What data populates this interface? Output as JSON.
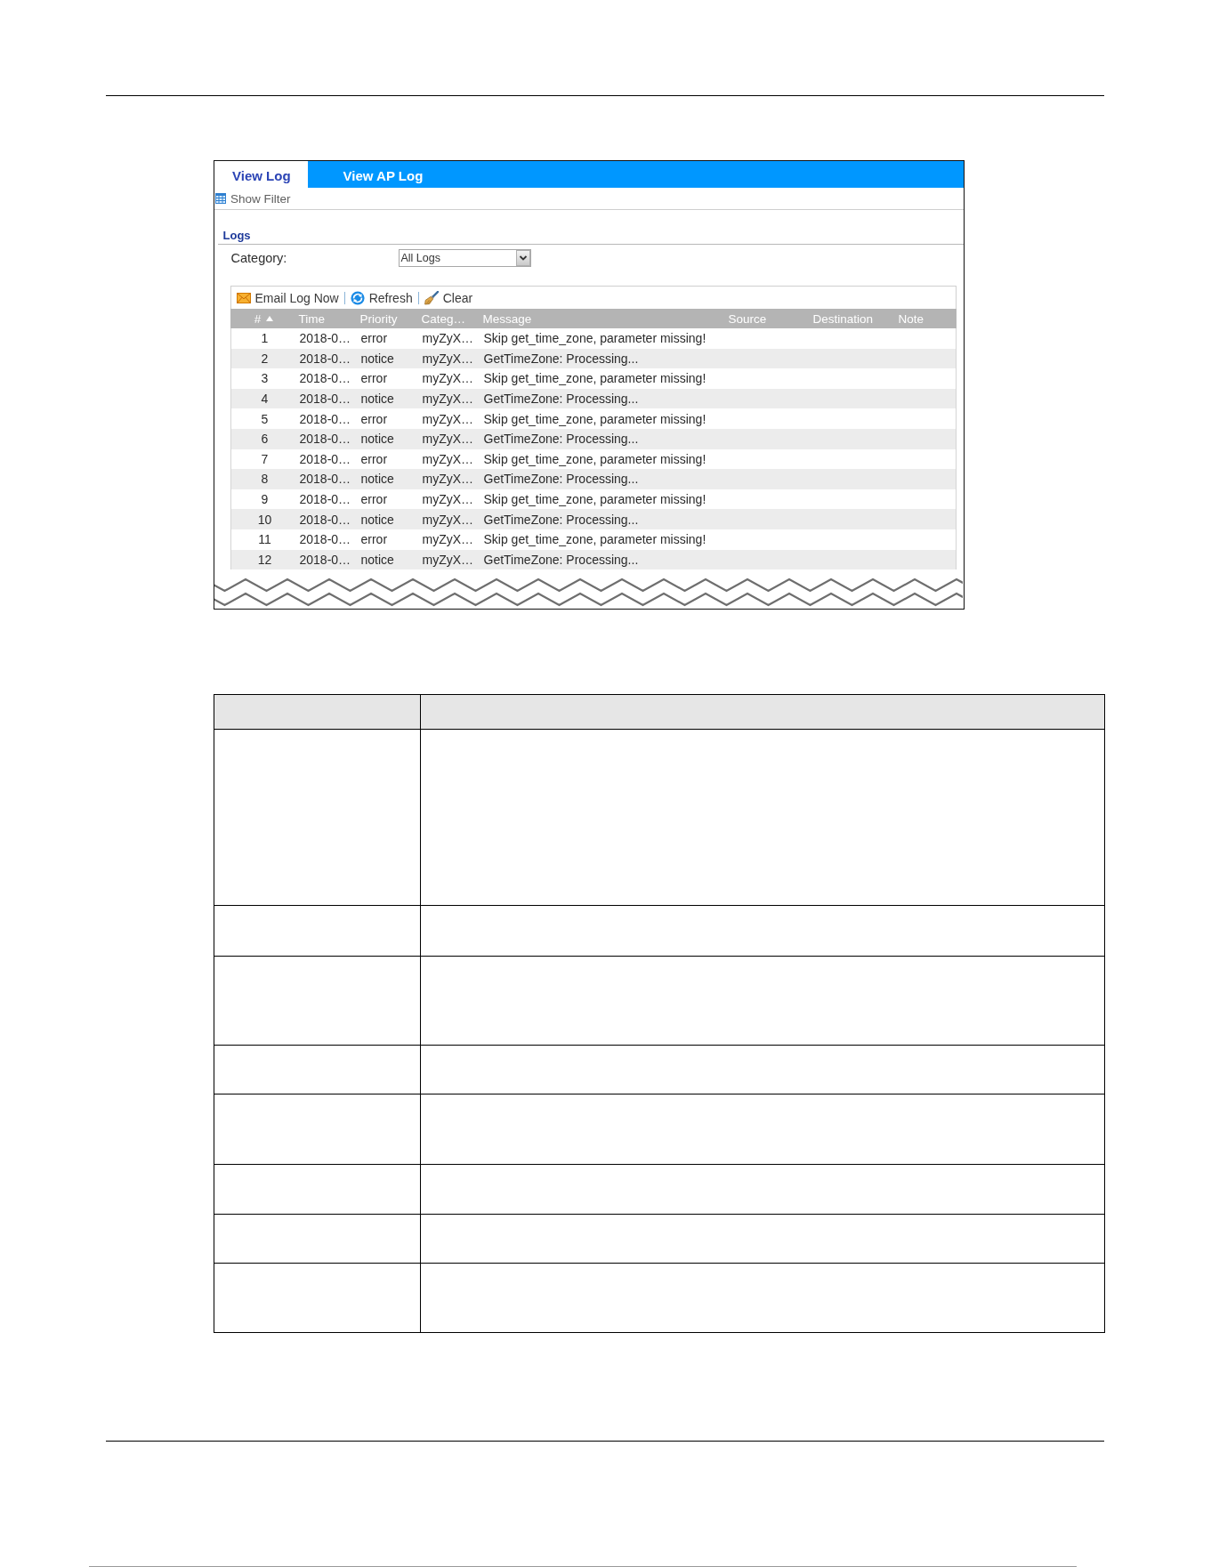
{
  "tabs": [
    {
      "label": "View Log",
      "selected": true
    },
    {
      "label": "View AP Log",
      "selected": false
    }
  ],
  "filter_toggle": {
    "label": "Show Filter"
  },
  "logs": {
    "title": "Logs",
    "category": {
      "label": "Category:",
      "value": "All Logs"
    },
    "toolbar": [
      {
        "kind": "email",
        "label": "Email Log Now"
      },
      {
        "kind": "refresh",
        "label": "Refresh"
      },
      {
        "kind": "clear",
        "label": "Clear"
      }
    ],
    "table": {
      "columns": [
        {
          "label": "#",
          "sorted": true
        },
        {
          "label": "Time",
          "sorted": false
        },
        {
          "label": "Priority",
          "sorted": false
        },
        {
          "label": "Categ…",
          "sorted": false
        },
        {
          "label": "Message",
          "sorted": false
        },
        {
          "label": "Source",
          "sorted": false
        },
        {
          "label": "Destination",
          "sorted": false
        },
        {
          "label": "Note",
          "sorted": false
        }
      ],
      "rows": [
        {
          "cells": [
            "1",
            "2018-0…",
            "error",
            "myZyX…",
            "Skip get_time_zone, parameter missing!"
          ]
        },
        {
          "cells": [
            "2",
            "2018-0…",
            "notice",
            "myZyX…",
            "GetTimeZone: Processing..."
          ]
        },
        {
          "cells": [
            "3",
            "2018-0…",
            "error",
            "myZyX…",
            "Skip get_time_zone, parameter missing!"
          ]
        },
        {
          "cells": [
            "4",
            "2018-0…",
            "notice",
            "myZyX…",
            "GetTimeZone: Processing..."
          ]
        },
        {
          "cells": [
            "5",
            "2018-0…",
            "error",
            "myZyX…",
            "Skip get_time_zone, parameter missing!"
          ]
        },
        {
          "cells": [
            "6",
            "2018-0…",
            "notice",
            "myZyX…",
            "GetTimeZone: Processing..."
          ]
        },
        {
          "cells": [
            "7",
            "2018-0…",
            "error",
            "myZyX…",
            "Skip get_time_zone, parameter missing!"
          ]
        },
        {
          "cells": [
            "8",
            "2018-0…",
            "notice",
            "myZyX…",
            "GetTimeZone: Processing..."
          ]
        },
        {
          "cells": [
            "9",
            "2018-0…",
            "error",
            "myZyX…",
            "Skip get_time_zone, parameter missing!"
          ]
        },
        {
          "cells": [
            "10",
            "2018-0…",
            "notice",
            "myZyX…",
            "GetTimeZone: Processing..."
          ]
        },
        {
          "cells": [
            "11",
            "2018-0…",
            "error",
            "myZyX…",
            "Skip get_time_zone, parameter missing!"
          ]
        },
        {
          "cells": [
            "12",
            "2018-0…",
            "notice",
            "myZyX…",
            "GetTimeZone: Processing..."
          ]
        }
      ]
    }
  }
}
